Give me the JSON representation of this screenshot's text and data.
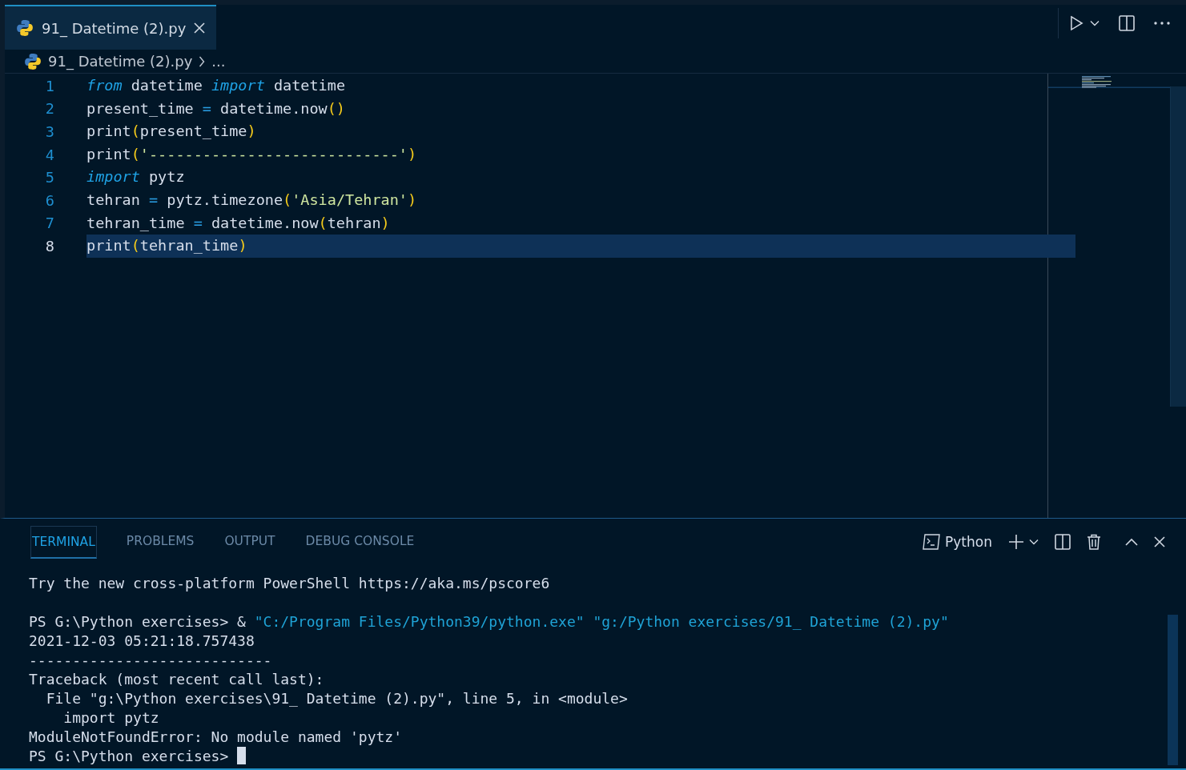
{
  "editor_tabs": [
    {
      "label": "91_ Datetime (2).py",
      "selected": true
    }
  ],
  "breadcrumb": {
    "file": "91_ Datetime (2).py",
    "more": "..."
  },
  "code_lines": [
    {
      "number": "1",
      "current": false,
      "tokens": [
        {
          "kind": "keyword",
          "text": "from"
        },
        {
          "kind": "name",
          "text": " datetime "
        },
        {
          "kind": "keyword",
          "text": "import"
        },
        {
          "kind": "name",
          "text": " datetime"
        }
      ]
    },
    {
      "number": "2",
      "current": false,
      "tokens": [
        {
          "kind": "name",
          "text": "present_time "
        },
        {
          "kind": "operator",
          "text": "="
        },
        {
          "kind": "name",
          "text": " datetime.now"
        },
        {
          "kind": "bracket",
          "text": "()"
        }
      ]
    },
    {
      "number": "3",
      "current": false,
      "tokens": [
        {
          "kind": "name",
          "text": "print"
        },
        {
          "kind": "bracket",
          "text": "("
        },
        {
          "kind": "name",
          "text": "present_time"
        },
        {
          "kind": "bracket",
          "text": ")"
        }
      ]
    },
    {
      "number": "4",
      "current": false,
      "tokens": [
        {
          "kind": "name",
          "text": "print"
        },
        {
          "kind": "bracket",
          "text": "("
        },
        {
          "kind": "string",
          "text": "'----------------------------'"
        },
        {
          "kind": "bracket",
          "text": ")"
        }
      ]
    },
    {
      "number": "5",
      "current": false,
      "tokens": [
        {
          "kind": "keyword",
          "text": "import"
        },
        {
          "kind": "name",
          "text": " pytz"
        }
      ]
    },
    {
      "number": "6",
      "current": false,
      "tokens": [
        {
          "kind": "name",
          "text": "tehran "
        },
        {
          "kind": "operator",
          "text": "="
        },
        {
          "kind": "name",
          "text": " pytz.timezone"
        },
        {
          "kind": "bracket",
          "text": "("
        },
        {
          "kind": "string",
          "text": "'Asia/Tehran'"
        },
        {
          "kind": "bracket",
          "text": ")"
        }
      ]
    },
    {
      "number": "7",
      "current": false,
      "tokens": [
        {
          "kind": "name",
          "text": "tehran_time "
        },
        {
          "kind": "operator",
          "text": "="
        },
        {
          "kind": "name",
          "text": " datetime.now"
        },
        {
          "kind": "bracket",
          "text": "("
        },
        {
          "kind": "name",
          "text": "tehran"
        },
        {
          "kind": "bracket",
          "text": ")"
        }
      ]
    },
    {
      "number": "8",
      "current": true,
      "tokens": [
        {
          "kind": "name",
          "text": "print"
        },
        {
          "kind": "bracket",
          "text": "("
        },
        {
          "kind": "name",
          "text": "tehran_time"
        },
        {
          "kind": "bracket",
          "text": ")"
        }
      ]
    }
  ],
  "panel_tabs": [
    {
      "label": "TERMINAL",
      "selected": true
    },
    {
      "label": "PROBLEMS",
      "selected": false
    },
    {
      "label": "OUTPUT",
      "selected": false
    },
    {
      "label": "DEBUG CONSOLE",
      "selected": false
    }
  ],
  "terminal_profile": "Python",
  "terminal_lines": [
    {
      "gap_before": false,
      "cursor": false,
      "segments": [
        {
          "kind": "plain",
          "text": "Try the new cross-platform PowerShell https://aka.ms/pscore6"
        }
      ]
    },
    {
      "gap_before": true,
      "cursor": false,
      "segments": [
        {
          "kind": "plain",
          "text": "PS G:\\Python exercises> & "
        },
        {
          "kind": "string",
          "text": "\"C:/Program Files/Python39/python.exe\" \"g:/Python exercises/91_ Datetime (2).py\""
        }
      ]
    },
    {
      "gap_before": false,
      "cursor": false,
      "segments": [
        {
          "kind": "plain",
          "text": "2021-12-03 05:21:18.757438"
        }
      ]
    },
    {
      "gap_before": false,
      "cursor": false,
      "segments": [
        {
          "kind": "plain",
          "text": "----------------------------"
        }
      ]
    },
    {
      "gap_before": false,
      "cursor": false,
      "segments": [
        {
          "kind": "plain",
          "text": "Traceback (most recent call last):"
        }
      ]
    },
    {
      "gap_before": false,
      "cursor": false,
      "segments": [
        {
          "kind": "plain",
          "text": "  File \"g:\\Python exercises\\91_ Datetime (2).py\", line 5, in <module>"
        }
      ]
    },
    {
      "gap_before": false,
      "cursor": false,
      "segments": [
        {
          "kind": "plain",
          "text": "    import pytz"
        }
      ]
    },
    {
      "gap_before": false,
      "cursor": false,
      "segments": [
        {
          "kind": "plain",
          "text": "ModuleNotFoundError: No module named 'pytz'"
        }
      ]
    },
    {
      "gap_before": false,
      "cursor": true,
      "segments": [
        {
          "kind": "plain",
          "text": "PS G:\\Python exercises> "
        }
      ]
    }
  ]
}
